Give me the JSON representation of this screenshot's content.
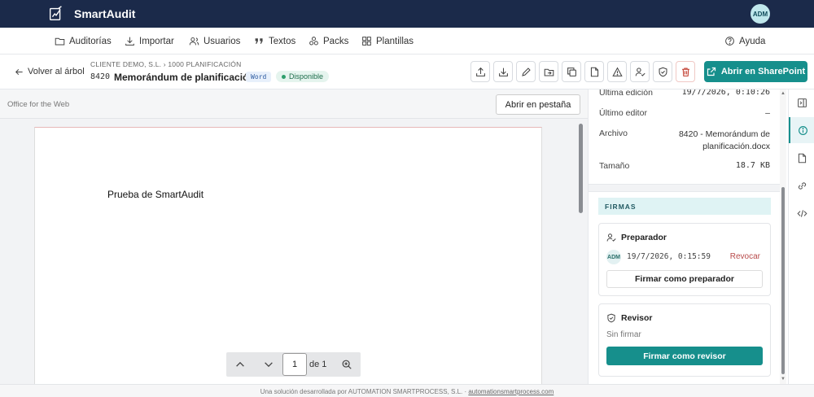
{
  "app": {
    "brand": "SmartAudit",
    "user_initials": "ADM"
  },
  "nav": {
    "items": [
      {
        "label": "Auditorías",
        "icon": "folder-icon"
      },
      {
        "label": "Importar",
        "icon": "download-icon"
      },
      {
        "label": "Usuarios",
        "icon": "users-icon"
      },
      {
        "label": "Textos",
        "icon": "quote-icon"
      },
      {
        "label": "Packs",
        "icon": "packs-icon"
      },
      {
        "label": "Plantillas",
        "icon": "grid-icon"
      }
    ],
    "help": "Ayuda"
  },
  "header": {
    "back": "Volver al árbol",
    "breadcrumb": "CLIENTE DEMO, S.L. › 1000 PLANIFICACIÓN",
    "code": "8420",
    "title": "Memorándum de planificación",
    "type_badge": "Word",
    "status_badge": "Disponible",
    "open_sharepoint": "Abrir en SharePoint"
  },
  "toolbar": {
    "icons": [
      "upload-icon",
      "download-icon",
      "edit-icon",
      "move-folder-icon",
      "copy-icon",
      "file-icon",
      "warning-icon",
      "assign-user-icon",
      "shield-icon",
      "trash-icon"
    ]
  },
  "viewer": {
    "label": "Office for the Web",
    "open_tab": "Abrir en pestaña",
    "doc_text": "Prueba de SmartAudit",
    "page_current": "1",
    "page_of": "de 1"
  },
  "details": {
    "last_edit_label": "Última edición",
    "last_edit_value": "19/7/2026, 0:10:26",
    "last_editor_label": "Último editor",
    "last_editor_value": "–",
    "file_label": "Archivo",
    "file_value": "8420 - Memorándum de planificación.docx",
    "size_label": "Tamaño",
    "size_value": "18.7 KB"
  },
  "firmas": {
    "header": "FIRMAS",
    "preparador": {
      "title": "Preparador",
      "initials": "ADM",
      "date": "19/7/2026, 0:15:59",
      "revoke": "Revocar",
      "button": "Firmar como preparador"
    },
    "revisor": {
      "title": "Revisor",
      "status": "Sin firmar",
      "button": "Firmar como revisor"
    }
  },
  "footer": {
    "text": "Una solución desarrollada por AUTOMATION SMARTPROCESS, S.L. ·",
    "link": "automationsmartprocess.com"
  },
  "colors": {
    "topbar": "#1b2a4a",
    "accent": "#168f8c",
    "danger": "#c0392b"
  }
}
